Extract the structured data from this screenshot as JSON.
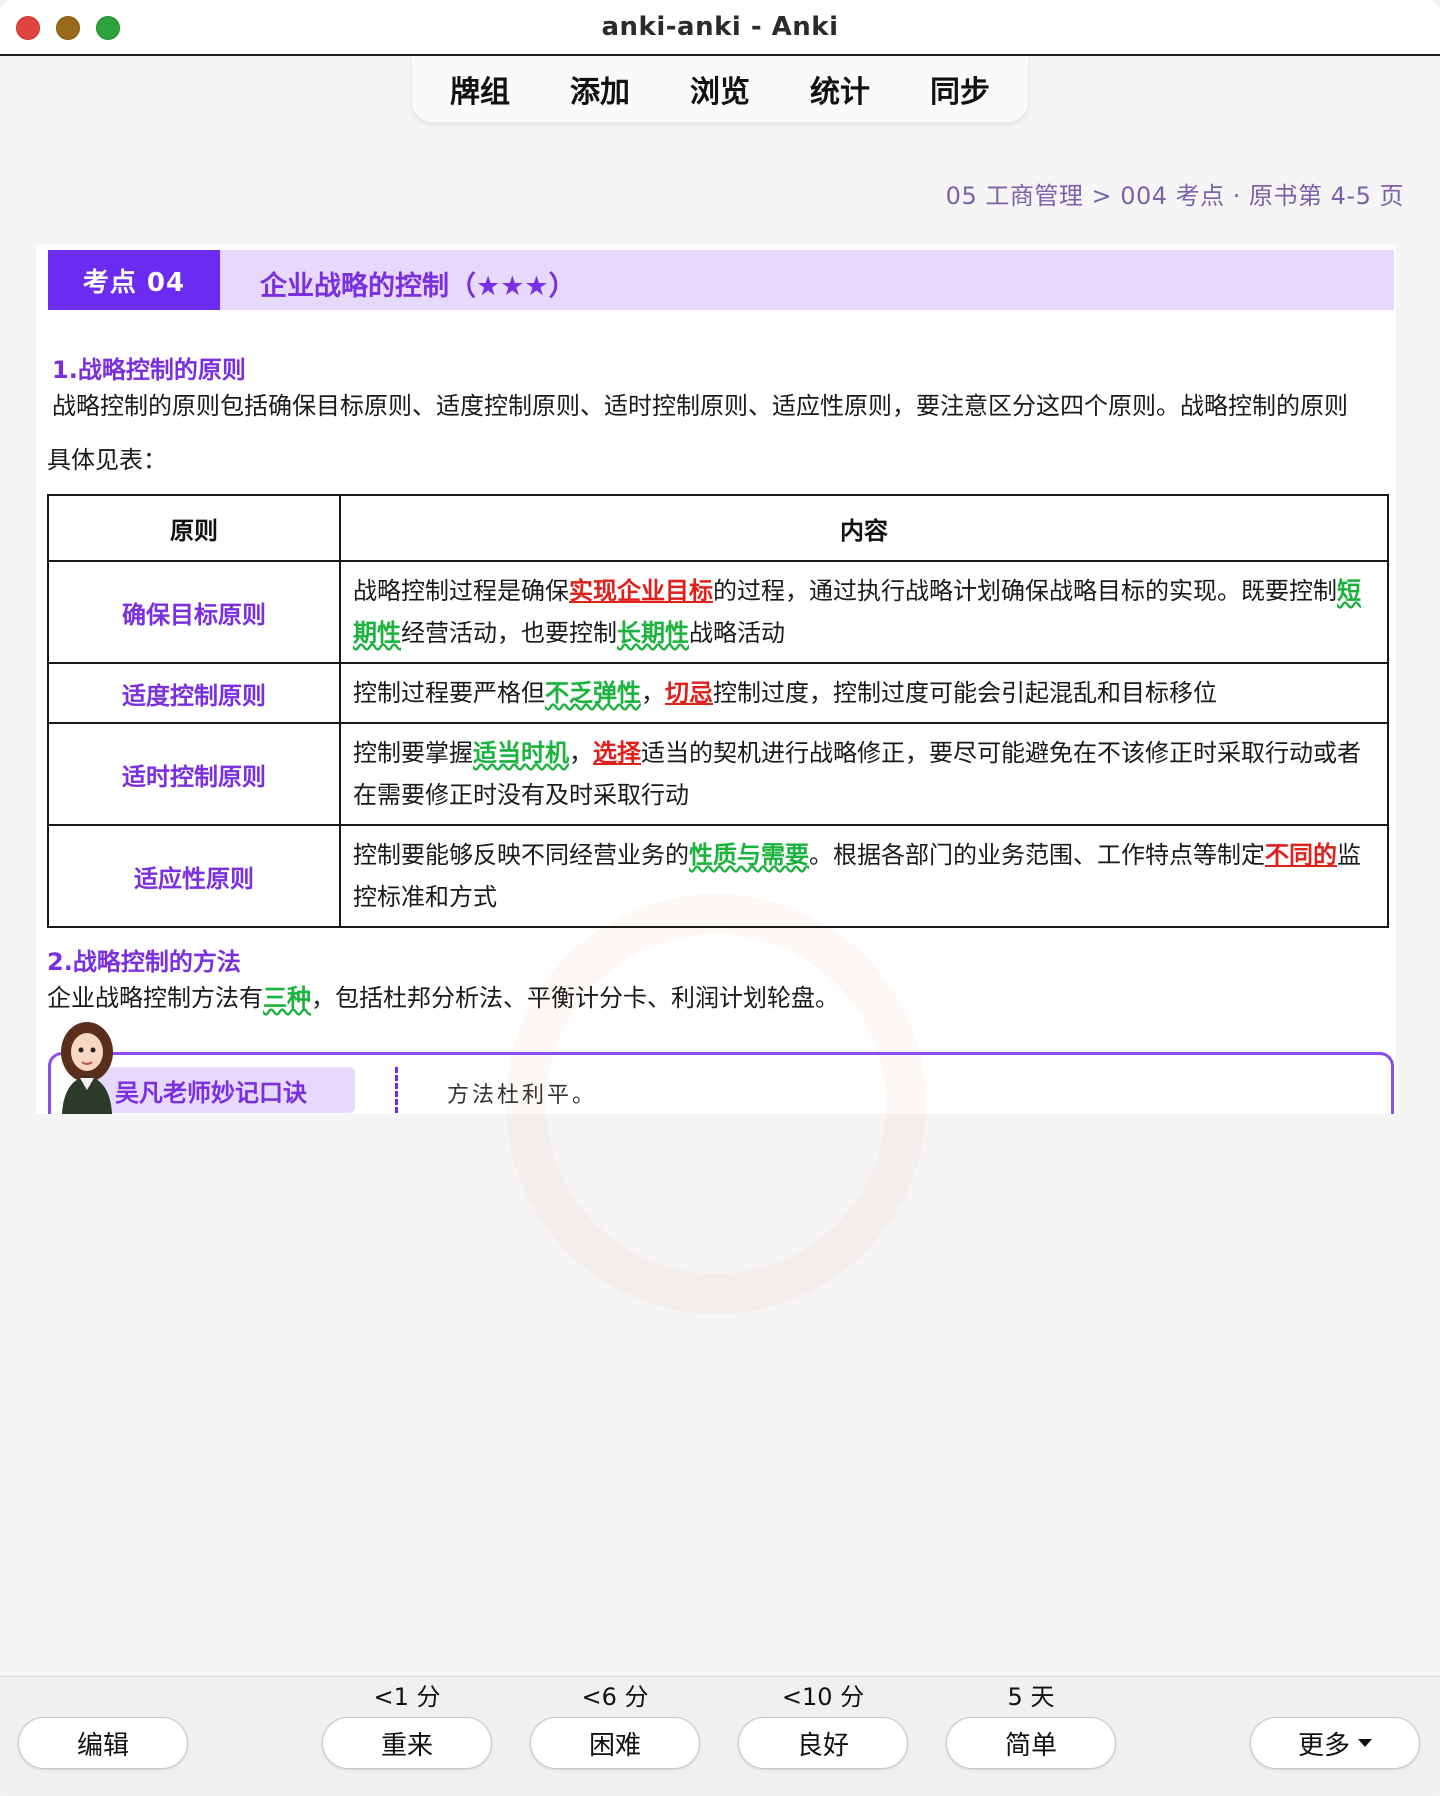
{
  "window": {
    "title": "anki-anki - Anki"
  },
  "toolbar": {
    "items": [
      "牌组",
      "添加",
      "浏览",
      "统计",
      "同步"
    ]
  },
  "breadcrumb": "05 工商管理 > 004 考点 · 原书第 4-5 页",
  "card": {
    "badge": "考点 04",
    "title": "企业战略的控制（★★★）",
    "section1": {
      "title": "1.战略控制的原则",
      "para_line1": "战略控制的原则包括确保目标原则、适度控制原则、适时控制原则、适应性原则，要注意区分这四个原则。战略控制的原则",
      "para_line2": "具体见表："
    },
    "table": {
      "headers": [
        "原则",
        "内容"
      ],
      "rows": [
        {
          "name": "确保目标原则",
          "segments": [
            {
              "text": "战略控制过程是确保",
              "style": "plain"
            },
            {
              "text": "实现企业目标",
              "style": "red"
            },
            {
              "text": "的过程，通过执行战略计划确保战略目标的实现。既要控制",
              "style": "plain"
            },
            {
              "text": "短期性",
              "style": "green"
            },
            {
              "text": "经营活动，也要控制",
              "style": "plain"
            },
            {
              "text": "长期性",
              "style": "green"
            },
            {
              "text": "战略活动",
              "style": "plain"
            }
          ]
        },
        {
          "name": "适度控制原则",
          "segments": [
            {
              "text": "控制过程要严格但",
              "style": "plain"
            },
            {
              "text": "不乏弹性",
              "style": "green"
            },
            {
              "text": "，",
              "style": "plain"
            },
            {
              "text": "切忌",
              "style": "red"
            },
            {
              "text": "控制过度，控制过度可能会引起混乱和目标移位",
              "style": "plain"
            }
          ]
        },
        {
          "name": "适时控制原则",
          "segments": [
            {
              "text": "控制要掌握",
              "style": "plain"
            },
            {
              "text": "适当时机",
              "style": "green"
            },
            {
              "text": "，",
              "style": "plain"
            },
            {
              "text": "选择",
              "style": "red"
            },
            {
              "text": "适当的契机进行战略修正，要尽可能避免在不该修正时采取行动或者在需要修正时没有及时采取行动",
              "style": "plain"
            }
          ]
        },
        {
          "name": "适应性原则",
          "segments": [
            {
              "text": "控制要能够反映不同经营业务的",
              "style": "plain"
            },
            {
              "text": "性质与需要",
              "style": "green"
            },
            {
              "text": "。根据各部门的业务范围、工作特点等制定",
              "style": "plain"
            },
            {
              "text": "不同的",
              "style": "red"
            },
            {
              "text": "监控标准和方式",
              "style": "plain"
            }
          ]
        }
      ]
    },
    "section2": {
      "title": "2.战略控制的方法",
      "pre": "企业战略控制方法有",
      "highlight": "三种",
      "post": "，包括杜邦分析法、平衡计分卡、利润计划轮盘。"
    },
    "mnemonic": {
      "label": "吴凡老师妙记口诀",
      "text": "方法杜利平。"
    }
  },
  "bottom": {
    "edit": "编辑",
    "answers": [
      {
        "time": "<1 分",
        "label": "重来"
      },
      {
        "time": "<6 分",
        "label": "困难"
      },
      {
        "time": "<10 分",
        "label": "良好"
      },
      {
        "time": "5 天",
        "label": "简单"
      }
    ],
    "more": "更多"
  },
  "colors": {
    "accent": "#6b2bf0",
    "accent_light": "#e6d9fb",
    "red": "#e0201a",
    "green": "#19b23c"
  },
  "icons": [
    "close-window-icon",
    "minimize-window-icon",
    "zoom-window-icon",
    "teacher-avatar-icon",
    "dropdown-caret-icon"
  ]
}
